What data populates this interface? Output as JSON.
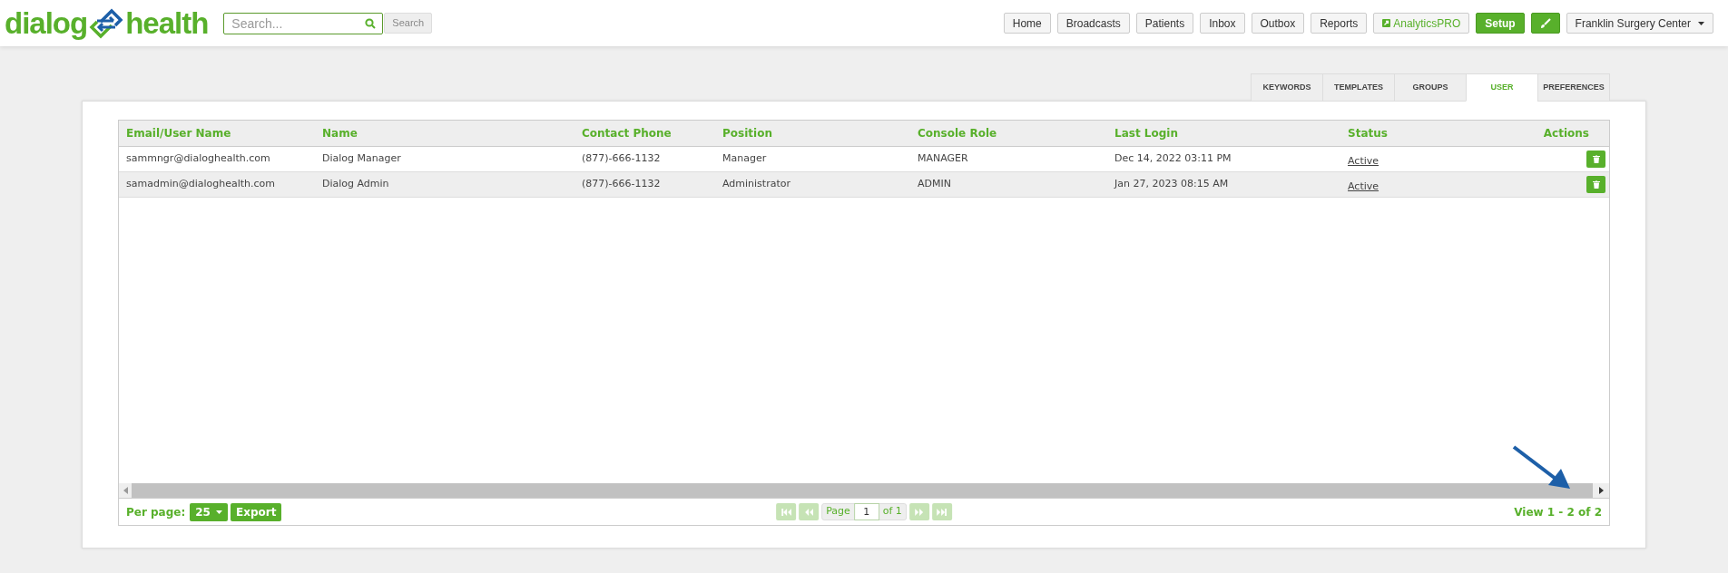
{
  "header": {
    "logo": {
      "left": "dialog",
      "right": "health"
    },
    "search": {
      "placeholder": "Search...",
      "button": "Search"
    },
    "nav": [
      {
        "label": "Home",
        "kind": "plain"
      },
      {
        "label": "Broadcasts",
        "kind": "plain"
      },
      {
        "label": "Patients",
        "kind": "plain"
      },
      {
        "label": "Inbox",
        "kind": "plain"
      },
      {
        "label": "Outbox",
        "kind": "plain"
      },
      {
        "label": "Reports",
        "kind": "plain"
      },
      {
        "label": "AnalyticsPRO",
        "kind": "external"
      },
      {
        "label": "Setup",
        "kind": "primary"
      },
      {
        "kind": "brush"
      },
      {
        "label": "Franklin Surgery Center",
        "kind": "dropdown"
      }
    ]
  },
  "tabs": [
    {
      "label": "KEYWORDS",
      "selected": false
    },
    {
      "label": "TEMPLATES",
      "selected": false
    },
    {
      "label": "GROUPS",
      "selected": false
    },
    {
      "label": "USER",
      "selected": true
    },
    {
      "label": "PREFERENCES",
      "selected": false
    }
  ],
  "table": {
    "columns": [
      "Email/User Name",
      "Name",
      "Contact Phone",
      "Position",
      "Console Role",
      "Last Login",
      "Status",
      "Actions"
    ],
    "rows": [
      {
        "cells": [
          "sammngr@dialoghealth.com",
          "Dialog Manager",
          "(877)-666-1132",
          "Manager",
          "MANAGER",
          "Dec 14, 2022 03:11 PM"
        ],
        "status": "Active",
        "shaded": false
      },
      {
        "cells": [
          "samadmin@dialoghealth.com",
          "Dialog Admin",
          "(877)-666-1132",
          "Administrator",
          "ADMIN",
          "Jan 27, 2023 08:15 AM"
        ],
        "status": "Active",
        "shaded": true
      }
    ]
  },
  "footer": {
    "per_page_label": "Per page:",
    "per_page": "25",
    "export": "Export",
    "page_label": "Page",
    "page": "1",
    "of": "of 1",
    "view": "View 1 - 2 of 2"
  }
}
